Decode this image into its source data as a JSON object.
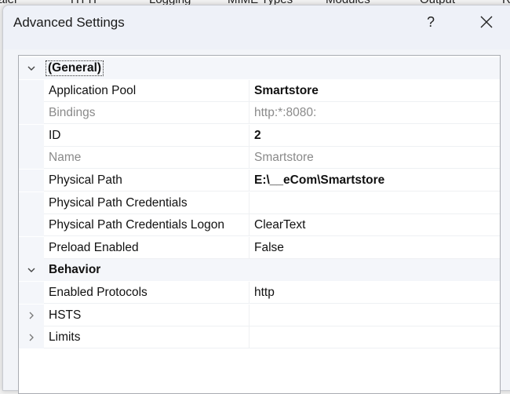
{
  "background_tabs": [
    "aler",
    "HTTP",
    "Logging",
    "MIME Types",
    "Modules",
    "Output",
    "R"
  ],
  "dialog": {
    "title": "Advanced Settings",
    "help_label": "?"
  },
  "grid": {
    "categories": [
      {
        "label": "(General)",
        "expanded": true,
        "rows": [
          {
            "name": "Application Pool",
            "value": "Smartstore",
            "bold": true
          },
          {
            "name": "Bindings",
            "value": "http:*:8080:",
            "disabled": true
          },
          {
            "name": "ID",
            "value": "2",
            "bold": true
          },
          {
            "name": "Name",
            "value": "Smartstore",
            "disabled": true
          },
          {
            "name": "Physical Path",
            "value": "E:\\__eCom\\Smartstore",
            "bold": true
          },
          {
            "name": "Physical Path Credentials",
            "value": ""
          },
          {
            "name": "Physical Path Credentials Logon",
            "value": "ClearText"
          },
          {
            "name": "Preload Enabled",
            "value": "False"
          }
        ]
      },
      {
        "label": "Behavior",
        "expanded": true,
        "rows": [
          {
            "name": "Enabled Protocols",
            "value": "http"
          },
          {
            "name": "HSTS",
            "value": "",
            "expandable": true
          },
          {
            "name": "Limits",
            "value": "",
            "expandable": true
          }
        ]
      }
    ]
  }
}
